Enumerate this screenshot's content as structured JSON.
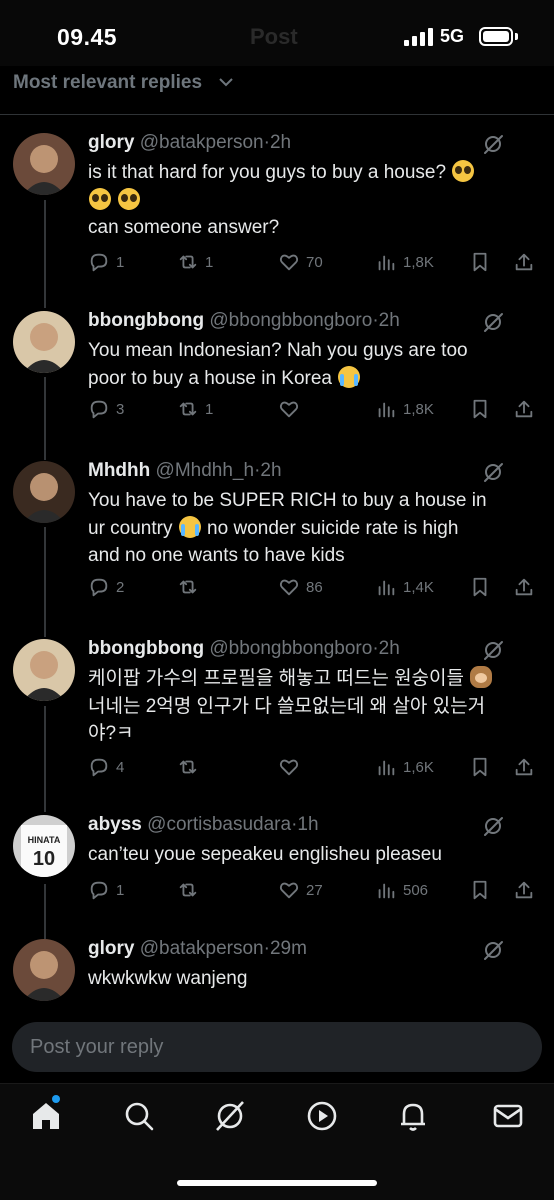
{
  "status_bar": {
    "time": "09.45",
    "faint_title": "Post",
    "network": "5G"
  },
  "sort": {
    "label": "Most relevant replies"
  },
  "replies": [
    {
      "name": "glory",
      "handle": "@batakperson",
      "time": "2h",
      "lines": [
        {
          "text": "is it that hard for you guys to buy a house?",
          "emojis": [
            "pleading"
          ]
        },
        {
          "text": "",
          "emojis": [
            "pleading",
            "pleading"
          ]
        },
        {
          "text": "can someone answer?",
          "emojis": []
        }
      ],
      "stats": {
        "replies": "1",
        "reposts": "1",
        "likes": "70",
        "views": "1,8K"
      },
      "avatar_color": "#6b4a3a"
    },
    {
      "name": "bbongbbong",
      "handle": "@bbongbbongboro",
      "time": "2h",
      "lines": [
        {
          "text": "You mean Indonesian? Nah you guys are too",
          "emojis": []
        },
        {
          "text": "poor to buy a house in Korea",
          "emojis": [
            "crying"
          ]
        }
      ],
      "stats": {
        "replies": "3",
        "reposts": "1",
        "likes": "",
        "views": "1,8K"
      },
      "avatar_color": "#d9c7a8"
    },
    {
      "name": "Mhdhh",
      "handle": "@Mhdhh_h",
      "time": "2h",
      "lines": [
        {
          "text": "You have to be SUPER RICH to buy a house in",
          "emojis": []
        },
        {
          "text": "ur country",
          "emojis": [
            "crying"
          ],
          "after": "no wonder suicide rate is high"
        },
        {
          "text": "and no one wants to have kids",
          "emojis": []
        }
      ],
      "stats": {
        "replies": "2",
        "reposts": "",
        "likes": "86",
        "views": "1,4K"
      },
      "avatar_color": "#3a2a20"
    },
    {
      "name": "bbongbbong",
      "handle": "@bbongbbongboro",
      "time": "2h",
      "lines": [
        {
          "text": "케이팝 가수의 프로필을 해놓고 떠드는 원숭이들",
          "emojis": [
            "monkey"
          ]
        },
        {
          "text": "너네는 2억명 인구가 다 쓸모없는데 왜 살아 있는거",
          "emojis": []
        },
        {
          "text": "야?ㅋ",
          "emojis": []
        }
      ],
      "stats": {
        "replies": "4",
        "reposts": "",
        "likes": "",
        "views": "1,6K"
      },
      "avatar_color": "#d9c7a8"
    },
    {
      "name": "abyss",
      "handle": "@cortisbasudara",
      "time": "1h",
      "lines": [
        {
          "text": "can’teu youe sepeakeu englisheu pleaseu",
          "emojis": []
        }
      ],
      "stats": {
        "replies": "1",
        "reposts": "",
        "likes": "27",
        "views": "506"
      },
      "avatar_color": "#cfcfcf",
      "avatar_text": "HINATA",
      "avatar_number": "10"
    },
    {
      "name": "glory",
      "handle": "@batakperson",
      "time": "29m",
      "lines": [
        {
          "text": "wkwkwkw wanjeng",
          "emojis": []
        }
      ],
      "avatar_color": "#6b4a3a"
    }
  ],
  "composer": {
    "placeholder": "Post your reply"
  },
  "tabs": [
    {
      "name": "home-icon",
      "active": true,
      "has_dot": true
    },
    {
      "name": "search-icon"
    },
    {
      "name": "grok-icon"
    },
    {
      "name": "video-icon"
    },
    {
      "name": "notifications-icon"
    },
    {
      "name": "messages-icon"
    }
  ],
  "colors": {
    "background": "#000000",
    "text": "#e7e9ea",
    "muted": "#71767b",
    "accent": "#1d9bf0",
    "divider": "#2f3336"
  }
}
